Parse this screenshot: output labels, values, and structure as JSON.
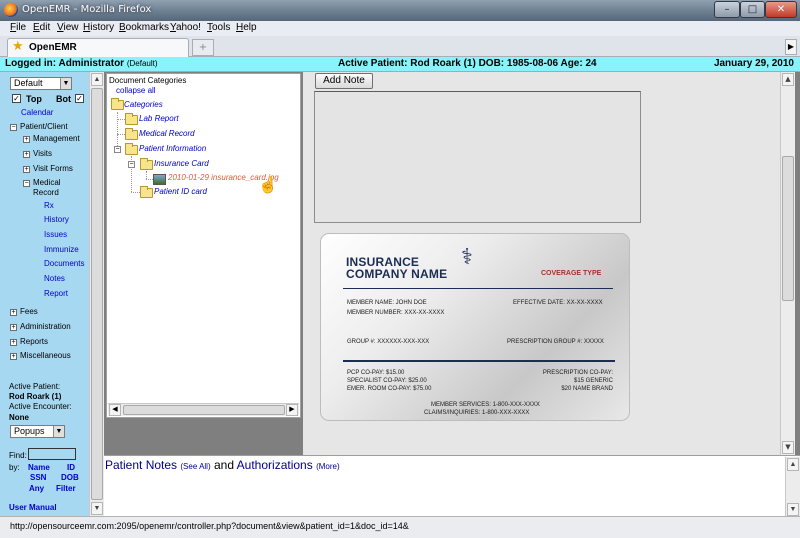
{
  "window": {
    "title": "OpenEMR - Mozilla Firefox",
    "min": "–",
    "max": "□",
    "close": "✕"
  },
  "menu": [
    "File",
    "Edit",
    "View",
    "History",
    "Bookmarks",
    "Yahoo!",
    "Tools",
    "Help"
  ],
  "tab": {
    "label": "OpenEMR",
    "new_tab": "+"
  },
  "header": {
    "logged_in": "Logged in: Administrator",
    "logged_in_note": "(Default)",
    "active_patient": "Active Patient: Rod Roark (1) DOB: 1985-08-06 Age: 24",
    "date": "January 29, 2010"
  },
  "nav": {
    "layout_select": "Default",
    "top_label": "Top",
    "bot_label": "Bot",
    "calendar": "Calendar",
    "patient_client": "Patient/Client",
    "management": "Management",
    "visits": "Visits",
    "visit_forms": "Visit Forms",
    "medical_record_1": "Medical",
    "medical_record_2": "Record",
    "rx": "Rx",
    "history": "History",
    "issues": "Issues",
    "immunize": "Immunize",
    "documents": "Documents",
    "notes": "Notes",
    "report": "Report",
    "fees": "Fees",
    "administration": "Administration",
    "reports": "Reports",
    "miscellaneous": "Miscellaneous",
    "active_patient_label": "Active Patient:",
    "active_patient_value": "Rod Roark (1)",
    "active_encounter_label": "Active Encounter:",
    "active_encounter_value": "None",
    "popups": "Popups",
    "find": "Find:",
    "by": "by:",
    "name": "Name",
    "id": "ID",
    "ssn": "SSN",
    "dob": "DOB",
    "any": "Any",
    "filter": "Filter",
    "user_manual": "User Manual"
  },
  "tree": {
    "heading": "Document Categories",
    "collapse_all": "collapse all",
    "categories": "Categories",
    "lab_report": "Lab Report",
    "medical_record": "Medical Record",
    "patient_information": "Patient Information",
    "insurance_card": "Insurance Card",
    "file": "2010-01-29 insurance_card.jpg",
    "patient_id_card": "Patient ID card"
  },
  "right": {
    "add_note": "Add Note"
  },
  "card": {
    "insurance": "INSURANCE",
    "company": "COMPANY NAME",
    "coverage": "COVERAGE TYPE",
    "member_name": "MEMBER NAME:  JOHN DOE",
    "member_number": "MEMBER NUMBER:  XXX-XX-XXXX",
    "effective": "EFFECTIVE DATE: XX-XX-XXXX",
    "group": "GROUP #:   XXXXXX-XXX-XXX",
    "rx_group": "PRESCRIPTION GROUP #:   XXXXX",
    "pcp": "PCP CO-PAY: $15.00",
    "specialist": "SPECIALIST CO-PAY: $25.00",
    "emer": "EMER. ROOM CO-PAY: $75.00",
    "rx_copay": "PRESCRIPTION CO-PAY:",
    "generic": "$15 GENERIC",
    "brand": "$20 NAME BRAND",
    "member_services": "MEMBER SERVICES: 1-800-XXX-XXXX",
    "claims": "CLAIMS/INQUIRIES: 1-800-XXX-XXXX"
  },
  "notes": {
    "patient_notes": "Patient Notes",
    "see_all": "(See All)",
    "and": "and",
    "authorizations": "Authorizations",
    "more": "(More)"
  },
  "status": {
    "url": "http://opensourceemr.com:2095/openemr/controller.php?document&view&patient_id=1&doc_id=14&"
  }
}
